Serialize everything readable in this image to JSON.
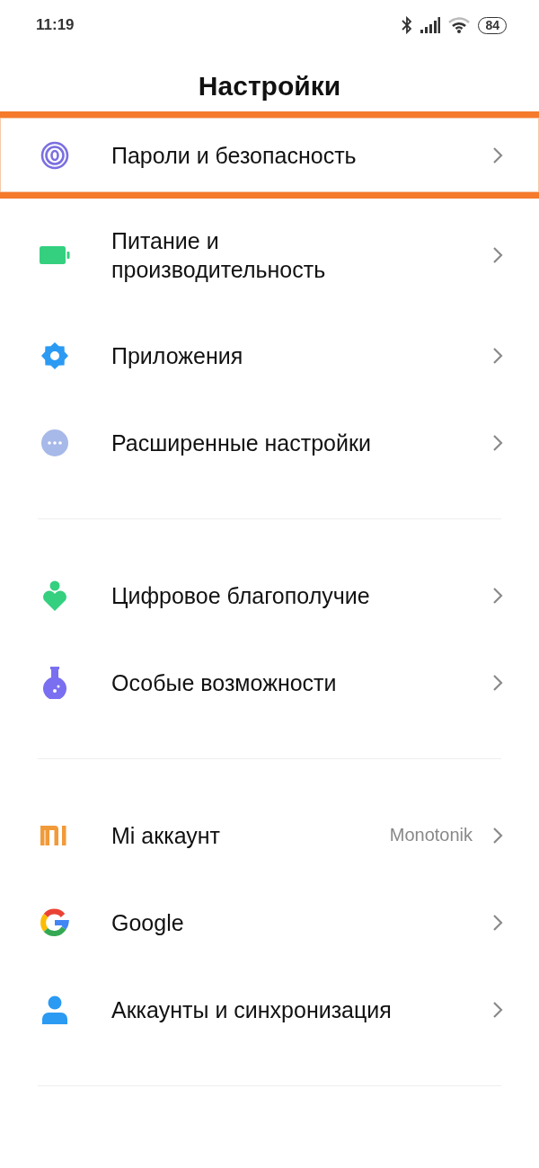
{
  "status_bar": {
    "time": "11:19",
    "battery": "84"
  },
  "title": "Настройки",
  "groups": [
    {
      "items": [
        {
          "label": "Пароли и безопасность",
          "highlighted": true
        },
        {
          "label": "Питание и производительность",
          "highlighted": false
        },
        {
          "label": "Приложения",
          "highlighted": false
        },
        {
          "label": "Расширенные настройки",
          "highlighted": false
        }
      ]
    },
    {
      "items": [
        {
          "label": "Цифровое благополучие",
          "highlighted": false
        },
        {
          "label": "Особые возможности",
          "highlighted": false
        }
      ]
    },
    {
      "items": [
        {
          "label": "Mi аккаунт",
          "value": "Monotonik",
          "highlighted": false
        },
        {
          "label": "Google",
          "highlighted": false
        },
        {
          "label": "Аккаунты и синхронизация",
          "highlighted": false
        }
      ]
    }
  ]
}
